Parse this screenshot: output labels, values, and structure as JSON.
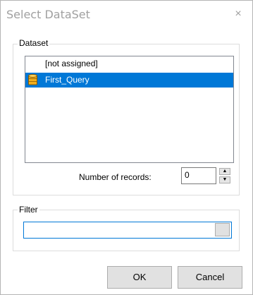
{
  "dialog": {
    "title": "Select DataSet",
    "close_glyph": "×"
  },
  "dataset": {
    "group_label": "Dataset",
    "items": [
      {
        "label": "[not assigned]",
        "selected": false,
        "icon": null
      },
      {
        "label": "First_Query",
        "selected": true,
        "icon": "database-icon"
      }
    ],
    "records_label": "Number of records:",
    "records_value": "0"
  },
  "filter": {
    "group_label": "Filter",
    "value": ""
  },
  "buttons": {
    "ok_label": "OK",
    "cancel_label": "Cancel"
  },
  "colors": {
    "selection": "#0078d7",
    "title_text": "#a0a0a0",
    "focus_border": "#0078d7"
  }
}
